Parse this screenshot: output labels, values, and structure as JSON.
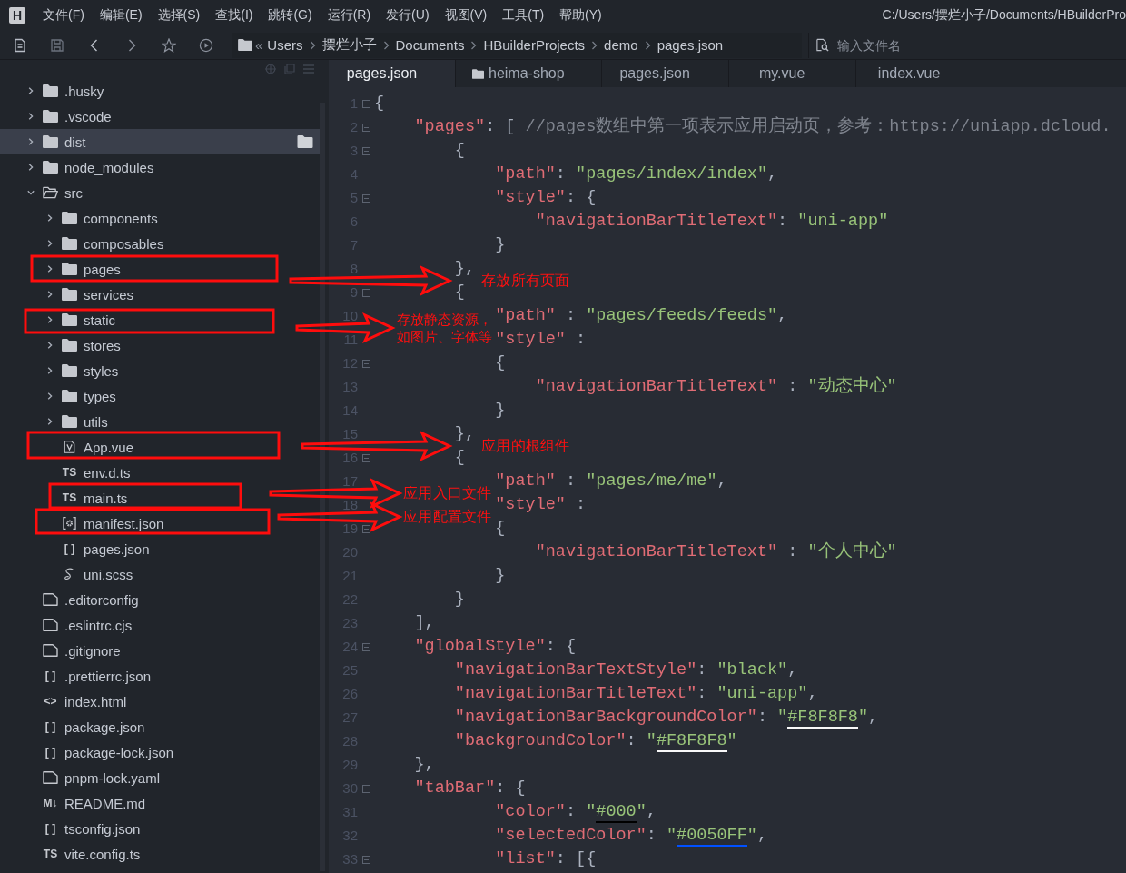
{
  "window": {
    "logo": "H",
    "menu": [
      "文件(F)",
      "编辑(E)",
      "选择(S)",
      "查找(I)",
      "跳转(G)",
      "运行(R)",
      "发行(U)",
      "视图(V)",
      "工具(T)",
      "帮助(Y)"
    ],
    "path": "C:/Users/摆烂小子/Documents/HBuilderPro"
  },
  "toolbar": {
    "breadcrumb": {
      "overflow_mark": "«",
      "items": [
        "Users",
        "摆烂小子",
        "Documents",
        "HBuilderProjects",
        "demo",
        "pages.json"
      ]
    },
    "search": {
      "placeholder": "输入文件名"
    }
  },
  "sidebar": {
    "tree": [
      {
        "name": ".husky",
        "kind": "folder",
        "expanded": false,
        "selected": false
      },
      {
        "name": ".vscode",
        "kind": "folder",
        "expanded": false,
        "selected": false
      },
      {
        "name": "dist",
        "kind": "folder",
        "expanded": false,
        "selected": true
      },
      {
        "name": "node_modules",
        "kind": "folder",
        "expanded": false,
        "selected": false
      },
      {
        "name": "src",
        "kind": "folder",
        "expanded": true,
        "selected": false,
        "children": [
          {
            "name": "components",
            "kind": "folder",
            "expanded": false,
            "selected": false
          },
          {
            "name": "composables",
            "kind": "folder",
            "expanded": false,
            "selected": false
          },
          {
            "name": "pages",
            "kind": "folder",
            "expanded": false,
            "selected": false
          },
          {
            "name": "services",
            "kind": "folder",
            "expanded": false,
            "selected": false
          },
          {
            "name": "static",
            "kind": "folder",
            "expanded": false,
            "selected": false
          },
          {
            "name": "stores",
            "kind": "folder",
            "expanded": false,
            "selected": false
          },
          {
            "name": "styles",
            "kind": "folder",
            "expanded": false,
            "selected": false
          },
          {
            "name": "types",
            "kind": "folder",
            "expanded": false,
            "selected": false
          },
          {
            "name": "utils",
            "kind": "folder",
            "expanded": false,
            "selected": false
          },
          {
            "name": "App.vue",
            "kind": "vue",
            "selected": false
          },
          {
            "name": "env.d.ts",
            "kind": "glyph",
            "glyph": "TS",
            "selected": false
          },
          {
            "name": "main.ts",
            "kind": "glyph",
            "glyph": "TS",
            "selected": false
          },
          {
            "name": "manifest.json",
            "kind": "settings",
            "selected": false
          },
          {
            "name": "pages.json",
            "kind": "glyph",
            "glyph": "[ ]",
            "selected": false
          },
          {
            "name": "uni.scss",
            "kind": "sass",
            "selected": false
          }
        ]
      },
      {
        "name": ".editorconfig",
        "kind": "plain",
        "selected": false
      },
      {
        "name": ".eslintrc.cjs",
        "kind": "plain",
        "selected": false
      },
      {
        "name": ".gitignore",
        "kind": "plain",
        "selected": false
      },
      {
        "name": ".prettierrc.json",
        "kind": "glyph",
        "glyph": "[ ]",
        "selected": false
      },
      {
        "name": "index.html",
        "kind": "glyph",
        "glyph": "<>",
        "selected": false
      },
      {
        "name": "package.json",
        "kind": "glyph",
        "glyph": "[ ]",
        "selected": false
      },
      {
        "name": "package-lock.json",
        "kind": "glyph",
        "glyph": "[ ]",
        "selected": false
      },
      {
        "name": "pnpm-lock.yaml",
        "kind": "plain",
        "selected": false
      },
      {
        "name": "README.md",
        "kind": "glyph",
        "glyph": "M↓",
        "selected": false
      },
      {
        "name": "tsconfig.json",
        "kind": "glyph",
        "glyph": "[ ]",
        "selected": false
      },
      {
        "name": "vite.config.ts",
        "kind": "glyph",
        "glyph": "TS",
        "selected": false
      }
    ]
  },
  "editor": {
    "tabs": [
      {
        "label": "pages.json",
        "kind": "file",
        "selected": true
      },
      {
        "label": "heima-shop",
        "kind": "project",
        "selected": false
      },
      {
        "label": "pages.json",
        "kind": "file",
        "selected": false
      },
      {
        "label": "my.vue",
        "kind": "file",
        "selected": false
      },
      {
        "label": "index.vue",
        "kind": "file",
        "selected": false
      }
    ],
    "lines": [
      {
        "number": "1",
        "foldable": true,
        "tokens": [
          {
            "text": "{",
            "kind": "punct"
          }
        ]
      },
      {
        "number": "2",
        "foldable": true,
        "tokens": [
          {
            "text": "    \"pages\"",
            "kind": "key"
          },
          {
            "text": ": [ ",
            "kind": "punct"
          },
          {
            "text": "//pages数组中第一项表示应用启动页，参考：https://uniapp.dcloud.",
            "kind": "comment"
          }
        ]
      },
      {
        "number": "3",
        "foldable": true,
        "tokens": [
          {
            "text": "        {",
            "kind": "punct"
          }
        ]
      },
      {
        "number": "4",
        "foldable": false,
        "tokens": [
          {
            "text": "            \"path\"",
            "kind": "key"
          },
          {
            "text": ": ",
            "kind": "punct"
          },
          {
            "text": "\"pages/index/index\"",
            "kind": "string"
          },
          {
            "text": ",",
            "kind": "punct"
          }
        ]
      },
      {
        "number": "5",
        "foldable": true,
        "tokens": [
          {
            "text": "            \"style\"",
            "kind": "key"
          },
          {
            "text": ": {",
            "kind": "punct"
          }
        ]
      },
      {
        "number": "6",
        "foldable": false,
        "tokens": [
          {
            "text": "                \"navigationBarTitleText\"",
            "kind": "key"
          },
          {
            "text": ": ",
            "kind": "punct"
          },
          {
            "text": "\"uni-app\"",
            "kind": "string"
          }
        ]
      },
      {
        "number": "7",
        "foldable": false,
        "tokens": [
          {
            "text": "            }",
            "kind": "punct"
          }
        ]
      },
      {
        "number": "8",
        "foldable": false,
        "tokens": [
          {
            "text": "        },",
            "kind": "punct"
          }
        ]
      },
      {
        "number": "9",
        "foldable": true,
        "tokens": [
          {
            "text": "        {",
            "kind": "punct"
          }
        ]
      },
      {
        "number": "10",
        "foldable": false,
        "tokens": [
          {
            "text": "            \"path\"",
            "kind": "key"
          },
          {
            "text": " : ",
            "kind": "punct"
          },
          {
            "text": "\"pages/feeds/feeds\"",
            "kind": "string"
          },
          {
            "text": ",",
            "kind": "punct"
          }
        ]
      },
      {
        "number": "11",
        "foldable": false,
        "tokens": [
          {
            "text": "            \"style\"",
            "kind": "key"
          },
          {
            "text": " :",
            "kind": "punct"
          }
        ]
      },
      {
        "number": "12",
        "foldable": true,
        "tokens": [
          {
            "text": "            {",
            "kind": "punct"
          }
        ]
      },
      {
        "number": "13",
        "foldable": false,
        "tokens": [
          {
            "text": "                \"navigationBarTitleText\"",
            "kind": "key"
          },
          {
            "text": " : ",
            "kind": "punct"
          },
          {
            "text": "\"动态中心\"",
            "kind": "string"
          }
        ]
      },
      {
        "number": "14",
        "foldable": false,
        "tokens": [
          {
            "text": "            }",
            "kind": "punct"
          }
        ]
      },
      {
        "number": "15",
        "foldable": false,
        "tokens": [
          {
            "text": "        },",
            "kind": "punct"
          }
        ]
      },
      {
        "number": "16",
        "foldable": true,
        "tokens": [
          {
            "text": "        {",
            "kind": "punct"
          }
        ]
      },
      {
        "number": "17",
        "foldable": false,
        "tokens": [
          {
            "text": "            \"path\"",
            "kind": "key"
          },
          {
            "text": " : ",
            "kind": "punct"
          },
          {
            "text": "\"pages/me/me\"",
            "kind": "string"
          },
          {
            "text": ",",
            "kind": "punct"
          }
        ]
      },
      {
        "number": "18",
        "foldable": false,
        "tokens": [
          {
            "text": "            \"style\"",
            "kind": "key"
          },
          {
            "text": " :",
            "kind": "punct"
          }
        ]
      },
      {
        "number": "19",
        "foldable": true,
        "tokens": [
          {
            "text": "            {",
            "kind": "punct"
          }
        ]
      },
      {
        "number": "20",
        "foldable": false,
        "tokens": [
          {
            "text": "                \"navigationBarTitleText\"",
            "kind": "key"
          },
          {
            "text": " : ",
            "kind": "punct"
          },
          {
            "text": "\"个人中心\"",
            "kind": "string"
          }
        ]
      },
      {
        "number": "21",
        "foldable": false,
        "tokens": [
          {
            "text": "            }",
            "kind": "punct"
          }
        ]
      },
      {
        "number": "22",
        "foldable": false,
        "tokens": [
          {
            "text": "        }",
            "kind": "punct"
          }
        ]
      },
      {
        "number": "23",
        "foldable": false,
        "tokens": [
          {
            "text": "    ],",
            "kind": "punct"
          }
        ]
      },
      {
        "number": "24",
        "foldable": true,
        "tokens": [
          {
            "text": "    \"globalStyle\"",
            "kind": "key"
          },
          {
            "text": ": {",
            "kind": "punct"
          }
        ]
      },
      {
        "number": "25",
        "foldable": false,
        "tokens": [
          {
            "text": "        \"navigationBarTextStyle\"",
            "kind": "key"
          },
          {
            "text": ": ",
            "kind": "punct"
          },
          {
            "text": "\"black\"",
            "kind": "string"
          },
          {
            "text": ",",
            "kind": "punct"
          }
        ]
      },
      {
        "number": "26",
        "foldable": false,
        "tokens": [
          {
            "text": "        \"navigationBarTitleText\"",
            "kind": "key"
          },
          {
            "text": ": ",
            "kind": "punct"
          },
          {
            "text": "\"uni-app\"",
            "kind": "string"
          },
          {
            "text": ",",
            "kind": "punct"
          }
        ]
      },
      {
        "number": "27",
        "foldable": false,
        "tokens": [
          {
            "text": "        \"navigationBarBackgroundColor\"",
            "kind": "key"
          },
          {
            "text": ": ",
            "kind": "punct"
          },
          {
            "text": "\"",
            "kind": "string"
          },
          {
            "text": "#F8F8F8",
            "kind": "string",
            "color": "#f8f8f8"
          },
          {
            "text": "\"",
            "kind": "string"
          },
          {
            "text": ",",
            "kind": "punct"
          }
        ]
      },
      {
        "number": "28",
        "foldable": false,
        "tokens": [
          {
            "text": "        \"backgroundColor\"",
            "kind": "key"
          },
          {
            "text": ": ",
            "kind": "punct"
          },
          {
            "text": "\"",
            "kind": "string"
          },
          {
            "text": "#F8F8F8",
            "kind": "string",
            "color": "#f8f8f8"
          },
          {
            "text": "\"",
            "kind": "string"
          }
        ]
      },
      {
        "number": "29",
        "foldable": false,
        "tokens": [
          {
            "text": "    },",
            "kind": "punct"
          }
        ]
      },
      {
        "number": "30",
        "foldable": true,
        "tokens": [
          {
            "text": "    \"tabBar\"",
            "kind": "key"
          },
          {
            "text": ": {",
            "kind": "punct"
          }
        ]
      },
      {
        "number": "31",
        "foldable": false,
        "tokens": [
          {
            "text": "            \"color\"",
            "kind": "key"
          },
          {
            "text": ": ",
            "kind": "punct"
          },
          {
            "text": "\"",
            "kind": "string"
          },
          {
            "text": "#000",
            "kind": "string",
            "color": "#000000"
          },
          {
            "text": "\"",
            "kind": "string"
          },
          {
            "text": ",",
            "kind": "punct"
          }
        ]
      },
      {
        "number": "32",
        "foldable": false,
        "tokens": [
          {
            "text": "            \"selectedColor\"",
            "kind": "key"
          },
          {
            "text": ": ",
            "kind": "punct"
          },
          {
            "text": "\"",
            "kind": "string"
          },
          {
            "text": "#0050FF",
            "kind": "string",
            "color": "#0050ff"
          },
          {
            "text": "\"",
            "kind": "string"
          },
          {
            "text": ",",
            "kind": "punct"
          }
        ]
      },
      {
        "number": "33",
        "foldable": true,
        "tokens": [
          {
            "text": "            \"list\"",
            "kind": "key"
          },
          {
            "text": ": [{",
            "kind": "punct"
          }
        ]
      }
    ]
  },
  "annotations": [
    {
      "label": "存放所有页面"
    },
    {
      "label": "存放静态资源，如图片、字体等"
    },
    {
      "label": "应用的根组件"
    },
    {
      "label": "应用入口文件"
    },
    {
      "label": "应用配置文件"
    }
  ]
}
